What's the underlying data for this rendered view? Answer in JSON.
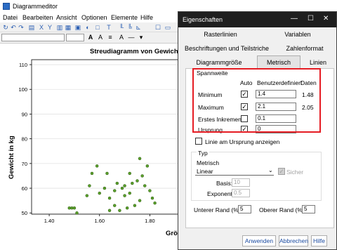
{
  "app": {
    "title": "Diagrammeditor"
  },
  "menu": {
    "items": [
      "Datei",
      "Bearbeiten",
      "Ansicht",
      "Optionen",
      "Elemente",
      "Hilfe"
    ]
  },
  "chart_data": {
    "type": "scatter",
    "title": "Streudiagramm von Gewicht i",
    "xlabel": "Größ",
    "ylabel": "Gewicht in kg",
    "x_ticks": [
      "1.40",
      "1.60",
      "1.80"
    ],
    "y_ticks": [
      "50",
      "60",
      "70",
      "80",
      "90",
      "100",
      "110"
    ],
    "xlim": [
      1.33,
      1.93
    ],
    "ylim": [
      49.5,
      112
    ],
    "grid": "horizontal",
    "points": [
      {
        "x": 1.48,
        "y": 52
      },
      {
        "x": 1.49,
        "y": 52
      },
      {
        "x": 1.5,
        "y": 52
      },
      {
        "x": 1.51,
        "y": 50
      },
      {
        "x": 1.55,
        "y": 57
      },
      {
        "x": 1.56,
        "y": 61
      },
      {
        "x": 1.57,
        "y": 66
      },
      {
        "x": 1.59,
        "y": 69
      },
      {
        "x": 1.6,
        "y": 58
      },
      {
        "x": 1.62,
        "y": 60
      },
      {
        "x": 1.63,
        "y": 66
      },
      {
        "x": 1.64,
        "y": 56
      },
      {
        "x": 1.66,
        "y": 53
      },
      {
        "x": 1.66,
        "y": 59
      },
      {
        "x": 1.67,
        "y": 62
      },
      {
        "x": 1.68,
        "y": 51
      },
      {
        "x": 1.7,
        "y": 57
      },
      {
        "x": 1.7,
        "y": 61
      },
      {
        "x": 1.71,
        "y": 52
      },
      {
        "x": 1.72,
        "y": 58
      },
      {
        "x": 1.73,
        "y": 62
      },
      {
        "x": 1.74,
        "y": 53
      },
      {
        "x": 1.75,
        "y": 63
      },
      {
        "x": 1.76,
        "y": 72
      },
      {
        "x": 1.76,
        "y": 55
      },
      {
        "x": 1.77,
        "y": 65
      },
      {
        "x": 1.78,
        "y": 61
      },
      {
        "x": 1.79,
        "y": 69
      },
      {
        "x": 1.8,
        "y": 59
      },
      {
        "x": 1.81,
        "y": 56
      },
      {
        "x": 1.82,
        "y": 54
      },
      {
        "x": 1.64,
        "y": 51
      },
      {
        "x": 1.69,
        "y": 60
      },
      {
        "x": 1.72,
        "y": 66
      }
    ],
    "point_color": "#5aa02c"
  },
  "dialog": {
    "title": "Eigenschaften",
    "tabs_row1": [
      "Rasterlinien",
      "Variablen"
    ],
    "tabs_row2": [
      "Beschriftungen und Teilstriche",
      "Zahlenformat"
    ],
    "tabs_row3": [
      "Diagrammgröße",
      "Metrisch",
      "Linien"
    ],
    "active_tab": "Metrisch",
    "range": {
      "group_label": "Spannweite",
      "col_auto": "Auto",
      "col_custom": "Benutzerdefiniert",
      "col_data": "Daten",
      "rows": [
        {
          "label": "Minimum",
          "auto": true,
          "custom": "1.4",
          "data": "1.48"
        },
        {
          "label": "Maximum",
          "auto": true,
          "custom": "2.1",
          "data": "2.05"
        },
        {
          "label": "Erstes Inkrement",
          "auto": false,
          "custom": "0.1",
          "data": ""
        },
        {
          "label": "Ursprung",
          "auto": true,
          "custom": "0",
          "data": ""
        }
      ]
    },
    "origin_line_label": "Linie am Ursprung anzeigen",
    "type_group": {
      "label": "Typ",
      "metric_label": "Metrisch",
      "scale_value": "Linear",
      "safe_label": "Sicher",
      "base_label": "Basis:",
      "base_value": "10",
      "exponent_label": "Exponent:",
      "exponent_value": "0.5"
    },
    "margins": {
      "lower_label": "Unterer Rand (%):",
      "lower_value": "5",
      "upper_label": "Oberer Rand (%):",
      "upper_value": "5"
    },
    "buttons": {
      "apply": "Anwenden",
      "cancel": "Abbrechen",
      "help": "Hilfe"
    },
    "highlight_color": "#e51c23"
  }
}
